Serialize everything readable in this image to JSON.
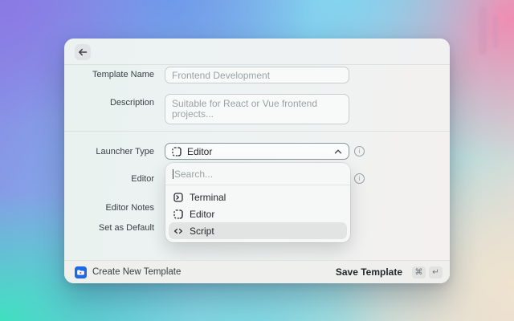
{
  "window": {
    "header": {
      "back_icon": "arrow-left"
    },
    "form": {
      "fields": [
        {
          "label": "Template Name",
          "placeholder": "Frontend Development"
        },
        {
          "label": "Description",
          "placeholder": "Suitable for React or Vue frontend projects..."
        },
        {
          "label": "Launcher Type",
          "value": "Editor"
        },
        {
          "label": "Editor"
        },
        {
          "label": "Editor Notes"
        },
        {
          "label": "Set as Default"
        }
      ]
    },
    "dropdown": {
      "search_placeholder": "Search...",
      "options": [
        {
          "label": "Terminal",
          "icon": "terminal-icon",
          "selected": false
        },
        {
          "label": "Editor",
          "icon": "editor-icon",
          "selected": false
        },
        {
          "label": "Script",
          "icon": "script-icon",
          "selected": true
        }
      ]
    },
    "footer": {
      "title": "Create New Template",
      "action": "Save Template",
      "shortcut_keys": [
        "⌘",
        "↵"
      ]
    }
  },
  "colors": {
    "app_icon_blue": "#1e68e6",
    "selection_highlight": "#e2e4e3",
    "window_background": "#eef3f2"
  }
}
